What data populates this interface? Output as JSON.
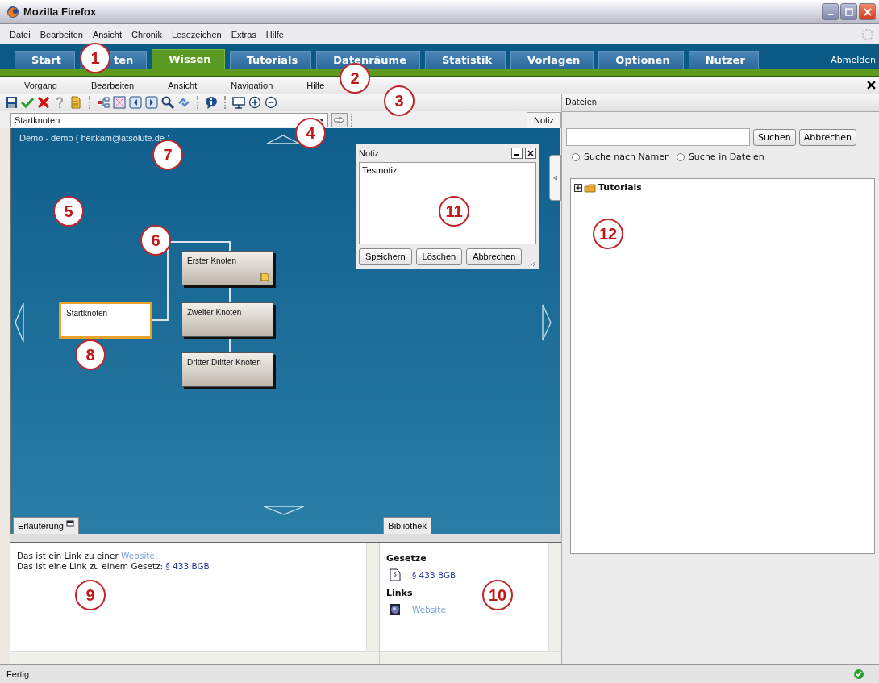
{
  "window": {
    "title": "Mozilla Firefox"
  },
  "browser_menu": [
    "Datei",
    "Bearbeiten",
    "Ansicht",
    "Chronik",
    "Lesezeichen",
    "Extras",
    "Hilfe"
  ],
  "app_tabs": [
    {
      "label": "Start",
      "selected": false
    },
    {
      "label": "ten",
      "selected": false
    },
    {
      "label": "Wissen",
      "selected": true
    },
    {
      "label": "Tutorials",
      "selected": false
    },
    {
      "label": "Datenräume",
      "selected": false
    },
    {
      "label": "Statistik",
      "selected": false
    },
    {
      "label": "Vorlagen",
      "selected": false
    },
    {
      "label": "Optionen",
      "selected": false
    },
    {
      "label": "Nutzer",
      "selected": false
    }
  ],
  "logout": "Abmelden",
  "app_menu": [
    "Vorgang",
    "Bearbeiten",
    "Ansicht",
    "Navigation",
    "Hilfe"
  ],
  "node_select": {
    "value": "Startknoten"
  },
  "note_tab": "Notiz",
  "canvas": {
    "caption": "Demo - demo ( heitkam@atsolute.de )",
    "nodes": [
      {
        "label": "Startknoten",
        "selected": true,
        "note": false
      },
      {
        "label": "Erster Knoten",
        "selected": false,
        "note": true
      },
      {
        "label": "Zweiter Knoten",
        "selected": false,
        "note": false
      },
      {
        "label": "Dritter Dritter Knoten",
        "selected": false,
        "note": false
      }
    ]
  },
  "note_window": {
    "title": "Notiz",
    "text": "Testnotiz",
    "buttons": [
      "Speichern",
      "Löschen",
      "Abbrechen"
    ]
  },
  "lower_tabs": [
    {
      "label": "Erläuterung"
    },
    {
      "label": "Bibliothek"
    }
  ],
  "explanation": [
    {
      "text": "Das ist ein Link zu einer ",
      "link": "Website",
      "visited": false,
      "after": "."
    },
    {
      "text": "Das ist eine Link zu einem Gesetz: ",
      "link": "§ 433 BGB",
      "visited": true
    }
  ],
  "library": [
    {
      "heading": "Gesetze",
      "items": [
        {
          "label": "§ 433 BGB",
          "kind": "law",
          "visited": true
        }
      ]
    },
    {
      "heading": "Links",
      "items": [
        {
          "label": "Website",
          "kind": "web",
          "visited": false
        }
      ]
    }
  ],
  "files_panel": {
    "title": "Dateien",
    "buttons": [
      "Suchen",
      "Abbrechen"
    ],
    "radios": [
      {
        "label": "Suche nach Namen",
        "selected": false
      },
      {
        "label": "Suche in Dateien",
        "selected": false
      }
    ],
    "tree": [
      {
        "label": "Tutorials",
        "expanded": false
      }
    ]
  },
  "status_bar": {
    "text": "Fertig"
  },
  "callouts": [
    "1",
    "2",
    "3",
    "4",
    "5",
    "6",
    "7",
    "8",
    "9",
    "10",
    "11",
    "12"
  ]
}
